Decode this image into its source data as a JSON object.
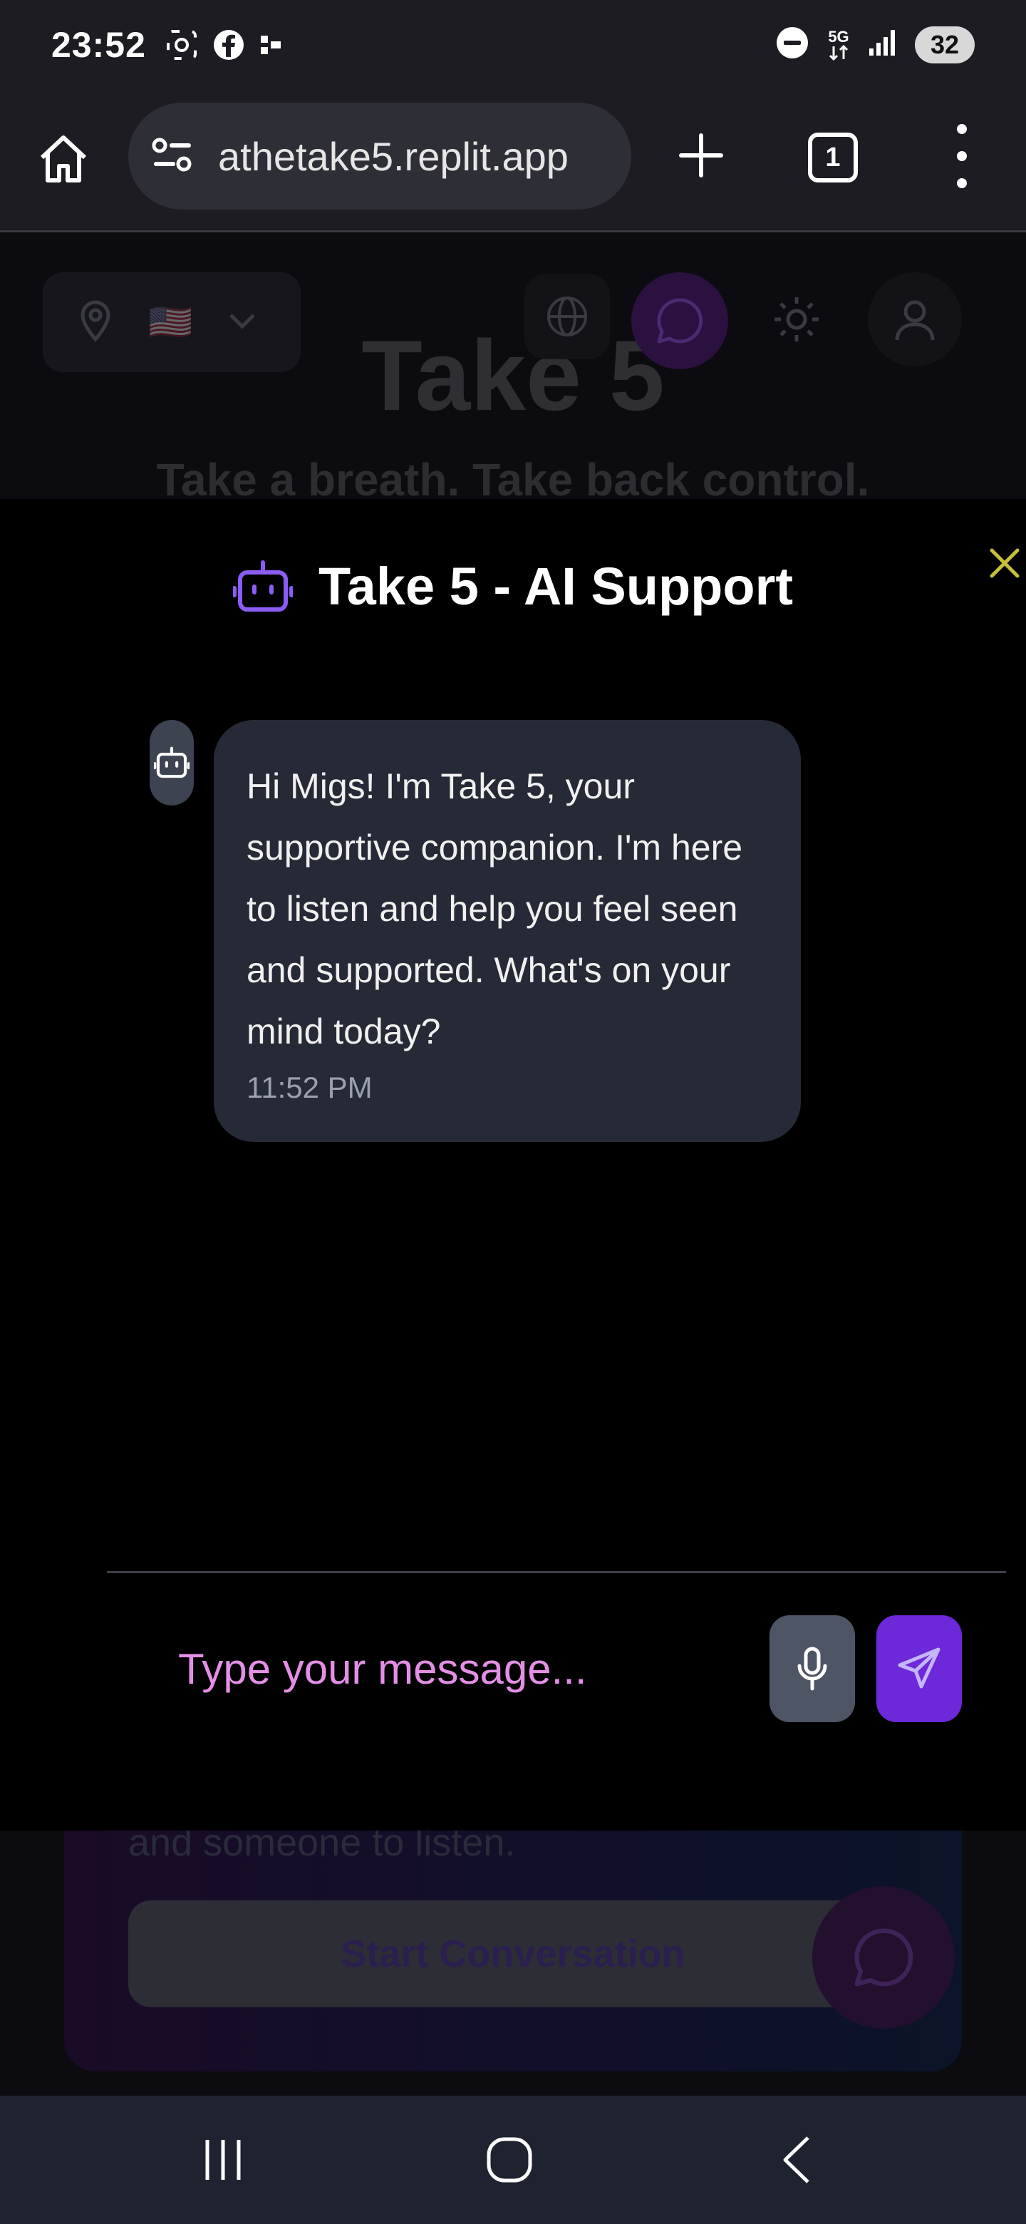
{
  "status_bar": {
    "time": "23:52",
    "network": "5G",
    "battery": "32",
    "left_icons": [
      "screenshot-icon",
      "facebook-icon",
      "notification-icon"
    ],
    "right_icons": [
      "do-not-disturb-icon",
      "network-5g-icon",
      "signal-icon",
      "battery-icon"
    ]
  },
  "browser": {
    "url": "athetake5.replit.app",
    "tab_count": "1"
  },
  "background_page": {
    "title": "Take 5",
    "tagline": "Take a breath. Take back control.",
    "flag": "🇺🇸",
    "card_text": "and someone to listen.",
    "start_button": "Start Conversation"
  },
  "chat": {
    "title": "Take 5 - AI Support",
    "messages": [
      {
        "sender": "bot",
        "text": "Hi Migs! I'm Take 5, your supportive companion. I'm here to listen and help you feel seen and supported. What's on your mind today?",
        "time": "11:52 PM"
      }
    ],
    "input_placeholder": "Type your message..."
  },
  "colors": {
    "accent": "#7c3aed",
    "send_button": "#6d28d9",
    "placeholder": "#e48fe6",
    "close_icon": "#c8c03a",
    "bubble": "#252a36"
  }
}
